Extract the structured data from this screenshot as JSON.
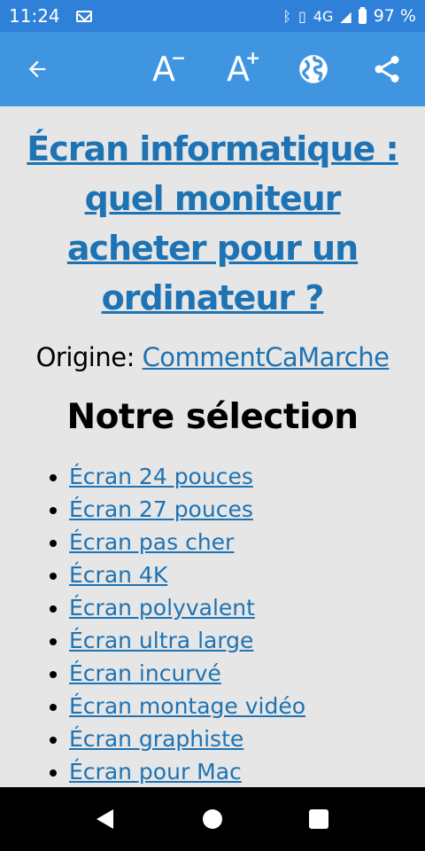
{
  "status": {
    "time": "11:24",
    "network": "4G",
    "battery": "97 %"
  },
  "toolbar": {
    "back_icon": "arrow-left-icon",
    "font_decrease_icon": "font-decrease-icon",
    "font_increase_icon": "font-increase-icon",
    "globe_icon": "globe-icon",
    "share_icon": "share-icon",
    "font_letter": "A",
    "minus": "−",
    "plus": "+"
  },
  "article": {
    "title": "Écran informatique : quel moniteur acheter pour un ordinateur ?",
    "origin_label": "Origine: ",
    "origin_link": "CommentCaMarche",
    "section_title": "Notre sélection",
    "items": [
      "Écran 24 pouces",
      "Écran 27 pouces",
      "Écran pas cher",
      "Écran 4K",
      "Écran polyvalent",
      "Écran ultra large",
      "Écran incurvé",
      "Écran montage vidéo",
      "Écran graphiste",
      "Écran pour Mac"
    ]
  },
  "colors": {
    "status_bar": "#2f80d9",
    "toolbar": "#4095e0",
    "link": "#1e73b4",
    "background": "#e6e6e6"
  }
}
